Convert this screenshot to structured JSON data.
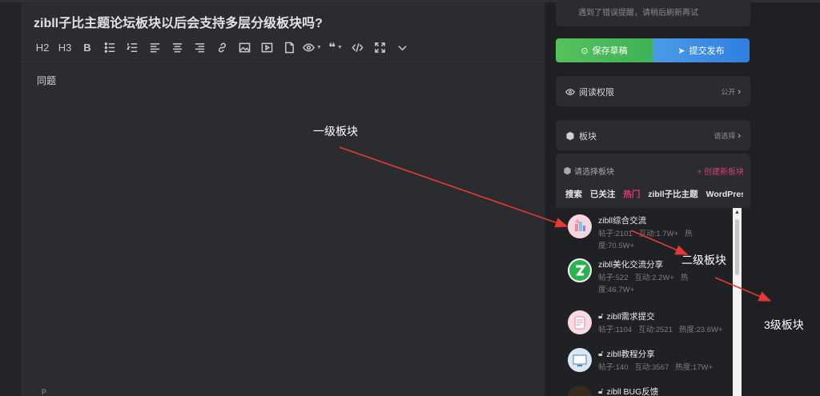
{
  "editor": {
    "title": "zibll子比主题论坛板块以后会支持多层分级板块吗?",
    "toolbar": [
      {
        "label": "H2",
        "icon": "heading-2"
      },
      {
        "label": "H3",
        "icon": "heading-3"
      },
      {
        "label": "B",
        "icon": "bold-icon"
      }
    ],
    "body": "同题",
    "status_path": "P"
  },
  "sidebar": {
    "error_text": "遇到了错误提醒，请稍后刷新再试",
    "save_draft": "保存草稿",
    "publish": "提交发布",
    "read_permission": {
      "label": "阅读权限",
      "value": "公开"
    },
    "forum": {
      "label": "板块",
      "value": "请选择"
    }
  },
  "picker": {
    "title": "请选择板块",
    "create": "+ 创建新板块",
    "tabs": [
      "搜索",
      "已关注",
      "热门",
      "zibll子比主题",
      "WordPress"
    ],
    "active_tab": "热门",
    "items": [
      {
        "name": "zibll综合交流",
        "posts": "帖子:2101",
        "interactions": "互动:1.7W+",
        "heat": "热度:70.5W+",
        "locked": false
      },
      {
        "name": "zibll美化交流分享",
        "posts": "帖子:522",
        "interactions": "互动:2.2W+",
        "heat": "热度:46.7W+",
        "locked": false
      },
      {
        "name": "zibll需求提交",
        "posts": "帖子:1104",
        "interactions": "互动:2521",
        "heat": "热度:23.6W+",
        "locked": true
      },
      {
        "name": "zibll教程分享",
        "posts": "帖子:140",
        "interactions": "互动:3567",
        "heat": "热度:17W+",
        "locked": true
      },
      {
        "name": "zibll BUG反馈",
        "posts": "",
        "interactions": "",
        "heat": "",
        "locked": true
      }
    ]
  },
  "annotations": {
    "level1": "一级板块",
    "level2": "二级板块",
    "level3": "3级板块"
  },
  "colors": {
    "accent": "#e0387a",
    "save": "#4cba5a",
    "publish": "#3a8ee6",
    "arrow": "#e53935"
  }
}
